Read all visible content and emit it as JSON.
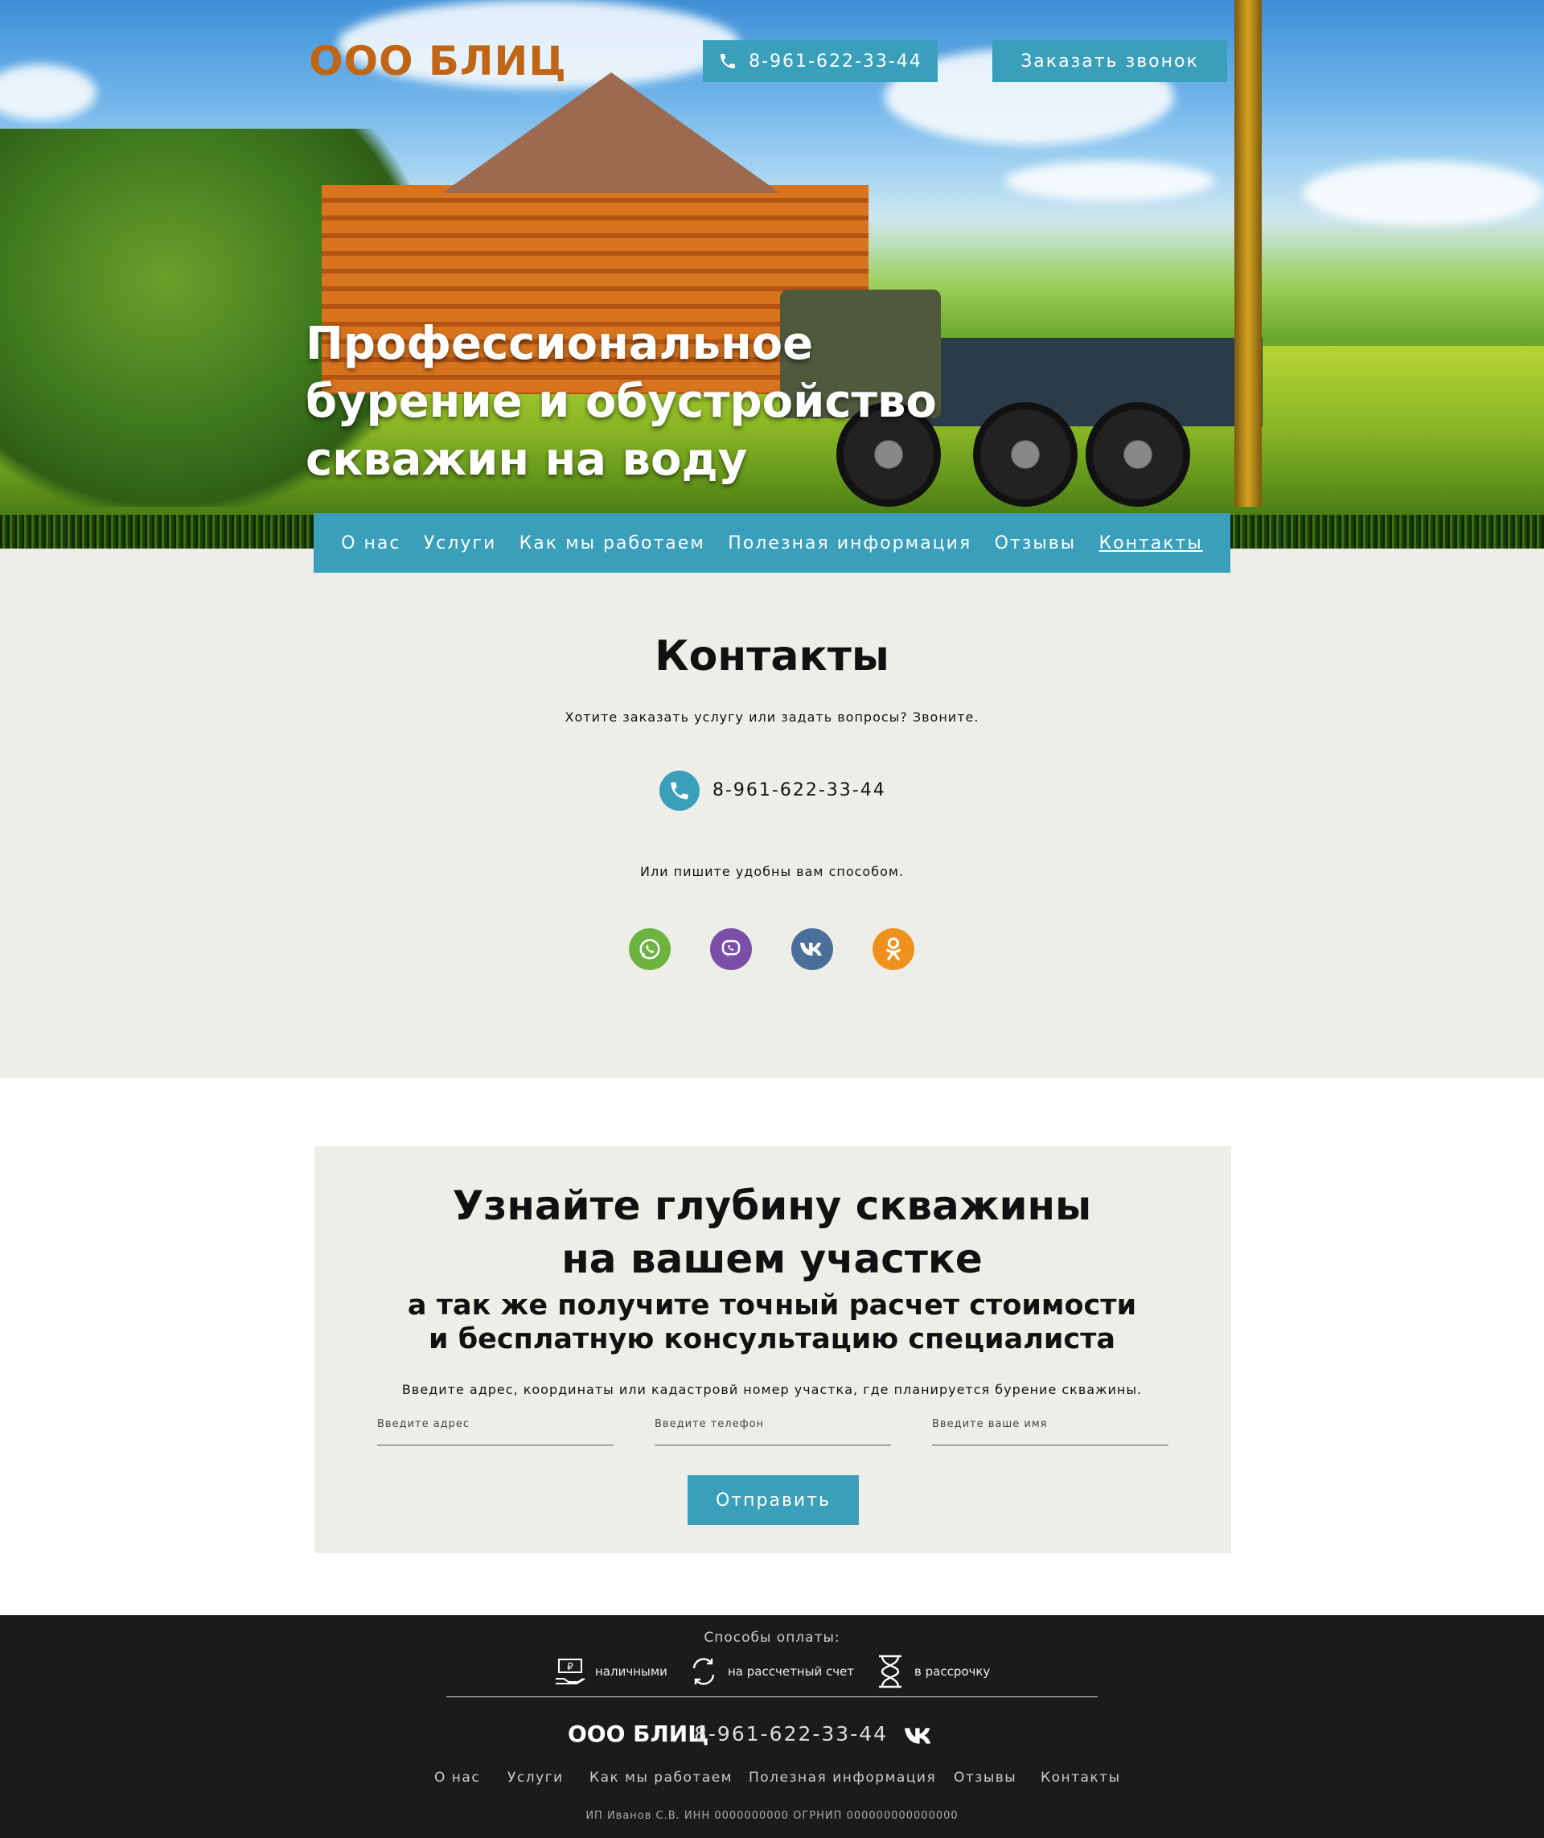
{
  "header": {
    "logo": "ООО БЛИЦ",
    "phone": "8-961-622-33-44",
    "callback_label": "Заказать звонок"
  },
  "hero": {
    "title_line1": "Профессиональное",
    "title_line2": "бурение и обустройство",
    "title_line3": "скважин на воду"
  },
  "nav": {
    "items": [
      {
        "label": "О нас"
      },
      {
        "label": "Услуги"
      },
      {
        "label": "Как мы работаем"
      },
      {
        "label": "Полезная информация"
      },
      {
        "label": "Отзывы"
      },
      {
        "label": "Контакты",
        "active": true
      }
    ]
  },
  "contacts": {
    "title": "Контакты",
    "lead": "Хотите заказать услугу или задать вопросы? Звоните.",
    "phone": "8-961-622-33-44",
    "write_text": "Или пишите удобны вам способом.",
    "socials": [
      {
        "name": "whatsapp",
        "color": "#6cb33f"
      },
      {
        "name": "viber",
        "color": "#7b4fa8"
      },
      {
        "name": "vk",
        "color": "#4a6f9a"
      },
      {
        "name": "odnoklassniki",
        "color": "#f0911e"
      }
    ]
  },
  "depth_form": {
    "title_line1": "Узнайте глубину скважины",
    "title_line2": "на вашем участке",
    "subtitle_line1": "а так же получите точный расчет стоимости",
    "subtitle_line2": "и бесплатную консультацию специалиста",
    "hint": "Введите адрес, координаты или кадастровй номер участка, где планируется бурение скважины.",
    "address_placeholder": "Введите адрес",
    "phone_placeholder": "Введите телефон",
    "name_placeholder": "Введите ваше имя",
    "submit_label": "Отправить"
  },
  "footer": {
    "payment_title": "Способы оплаты:",
    "payment_methods": [
      {
        "label": "наличными",
        "icon": "cash-icon"
      },
      {
        "label": "на рассчетный счет",
        "icon": "transfer-icon"
      },
      {
        "label": "в рассрочку",
        "icon": "hourglass-icon"
      }
    ],
    "logo": "ООО БЛИЦ",
    "phone": "8-961-622-33-44",
    "nav": [
      "О нас",
      "Услуги",
      "Как мы работаем",
      "Полезная информация",
      "Отзывы",
      "Контакты"
    ],
    "legal": "ИП Иванов С.В. ИНН 0000000000 ОГРНИП 000000000000000"
  },
  "colors": {
    "accent": "#3a9fbb",
    "logo": "#c06515",
    "section_bg": "#eeeee9",
    "footer_bg": "#1b1b1b"
  }
}
